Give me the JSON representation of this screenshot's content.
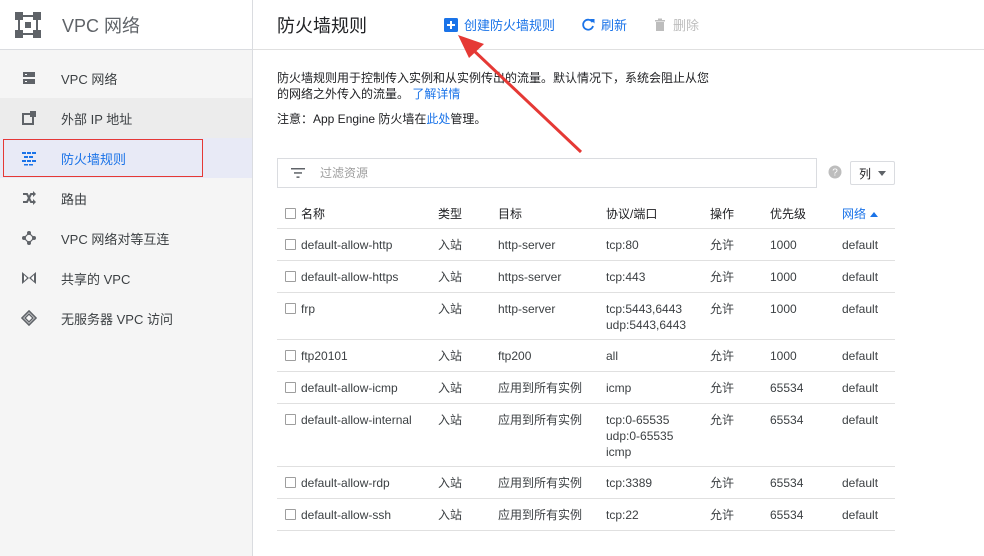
{
  "sidebar": {
    "title": "VPC 网络",
    "items": [
      {
        "label": "VPC 网络",
        "icon": "vpc-network-icon"
      },
      {
        "label": "外部 IP 地址",
        "icon": "external-ip-icon"
      },
      {
        "label": "防火墙规则",
        "icon": "firewall-icon",
        "active": true
      },
      {
        "label": "路由",
        "icon": "routes-icon"
      },
      {
        "label": "VPC 网络对等互连",
        "icon": "peering-icon"
      },
      {
        "label": "共享的 VPC",
        "icon": "shared-vpc-icon"
      },
      {
        "label": "无服务器 VPC 访问",
        "icon": "serverless-vpc-icon"
      }
    ]
  },
  "header": {
    "title": "防火墙规则",
    "create_label": "创建防火墙规则",
    "refresh_label": "刷新",
    "delete_label": "删除"
  },
  "description": {
    "text": "防火墙规则用于控制传入实例和从实例传出的流量。默认情况下，系统会阻止从您的网络之外传入的流量。",
    "link": "了解详情",
    "note_prefix": "注意：App Engine 防火墙在",
    "note_link": "此处",
    "note_suffix": "管理。"
  },
  "filter": {
    "placeholder": "过滤资源"
  },
  "columns_label": "列",
  "table": {
    "headers": [
      "名称",
      "类型",
      "目标",
      "协议/端口",
      "操作",
      "优先级",
      "网络"
    ],
    "rows": [
      {
        "name": "default-allow-http",
        "type": "入站",
        "target": "http-server",
        "ports": [
          "tcp:80"
        ],
        "action": "允许",
        "priority": "1000",
        "network": "default"
      },
      {
        "name": "default-allow-https",
        "type": "入站",
        "target": "https-server",
        "ports": [
          "tcp:443"
        ],
        "action": "允许",
        "priority": "1000",
        "network": "default"
      },
      {
        "name": "frp",
        "type": "入站",
        "target": "http-server",
        "ports": [
          "tcp:5443,6443",
          "udp:5443,6443"
        ],
        "action": "允许",
        "priority": "1000",
        "network": "default"
      },
      {
        "name": "ftp20101",
        "type": "入站",
        "target": "ftp200",
        "ports": [
          "all"
        ],
        "action": "允许",
        "priority": "1000",
        "network": "default"
      },
      {
        "name": "default-allow-icmp",
        "type": "入站",
        "target": "应用到所有实例",
        "ports": [
          "icmp"
        ],
        "action": "允许",
        "priority": "65534",
        "network": "default"
      },
      {
        "name": "default-allow-internal",
        "type": "入站",
        "target": "应用到所有实例",
        "ports": [
          "tcp:0-65535",
          "udp:0-65535",
          "icmp"
        ],
        "action": "允许",
        "priority": "65534",
        "network": "default"
      },
      {
        "name": "default-allow-rdp",
        "type": "入站",
        "target": "应用到所有实例",
        "ports": [
          "tcp:3389"
        ],
        "action": "允许",
        "priority": "65534",
        "network": "default"
      },
      {
        "name": "default-allow-ssh",
        "type": "入站",
        "target": "应用到所有实例",
        "ports": [
          "tcp:22"
        ],
        "action": "允许",
        "priority": "65534",
        "network": "default"
      }
    ]
  },
  "colors": {
    "accent": "#1a73e8",
    "annotation": "#e53935",
    "sidebar_bg": "#f5f5f5",
    "active_bg": "#e8eaf6"
  }
}
